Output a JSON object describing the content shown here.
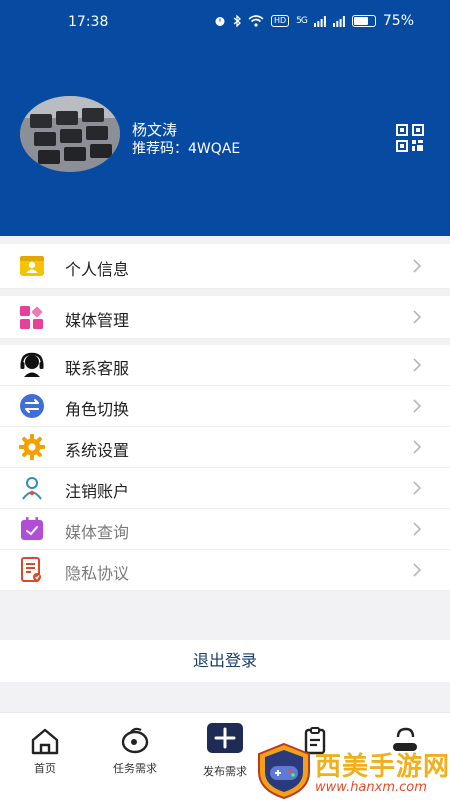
{
  "status_bar": {
    "time": "17:38",
    "network_badge": "HD",
    "signal_label": "5G",
    "battery": "75%",
    "battery_level": 0.75
  },
  "profile": {
    "name": "杨文涛",
    "referral_code": "推荐码：4WQAE"
  },
  "menu": [
    {
      "label": "个人信息",
      "icon": "person-card-icon",
      "color": "#f5c400"
    },
    {
      "label": "媒体管理",
      "icon": "grid-apps-icon",
      "color": "#e8409a"
    },
    {
      "label": "联系客服",
      "icon": "headset-icon",
      "color": "#111111"
    },
    {
      "label": "角色切换",
      "icon": "switch-arrows-icon",
      "color": "#3f6fd6"
    },
    {
      "label": "系统设置",
      "icon": "gear-icon",
      "color": "#f2a100"
    },
    {
      "label": "注销账户",
      "icon": "user-outline-icon",
      "color": "#2f8fb5"
    },
    {
      "label": "媒体查询",
      "icon": "calendar-check-icon",
      "color": "#b24dd8"
    },
    {
      "label": "隐私协议",
      "icon": "document-edit-icon",
      "color": "#d84a2a"
    }
  ],
  "logout_label": "退出登录",
  "tabs": [
    {
      "label": "首页",
      "icon": "home-icon"
    },
    {
      "label": "任务需求",
      "icon": "target-icon"
    },
    {
      "label": "发布需求",
      "icon": "plus-icon"
    },
    {
      "label": "",
      "icon": "clipboard-icon"
    },
    {
      "label": "",
      "icon": "profile-icon"
    }
  ],
  "watermark": {
    "title": "西美手游网",
    "url": "www.hanxm.com"
  },
  "colors": {
    "header": "#064ba1",
    "logout_text": "#1a3e6b",
    "publish_button": "#1d2b55"
  }
}
